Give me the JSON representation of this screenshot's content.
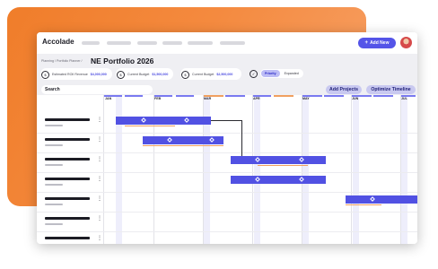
{
  "app": {
    "name": "Accolade"
  },
  "header": {
    "add_new_label": "Add New",
    "breadcrumb": "Planning / Portfolio Planner /",
    "title": "NE Portfolio 2026"
  },
  "kpis": [
    {
      "label": "Estimated ROII Revenue",
      "value": "$4,000,000",
      "icon": "$"
    },
    {
      "label": "Current Budget",
      "value": "$1,500,000",
      "icon": "$"
    },
    {
      "label": "Current Budget",
      "value": "$2,500,000",
      "icon": "$"
    }
  ],
  "view_toggle": {
    "options": [
      "Priority",
      "Expanded"
    ],
    "selected": "Priority",
    "icon": "check"
  },
  "search": {
    "placeholder": "Search"
  },
  "actions": {
    "add_projects": "Add Projects",
    "optimize_timeline": "Optimize Timeline"
  },
  "timeline": {
    "months": [
      "JAN",
      "FEB",
      "MAR",
      "APR",
      "MAY",
      "JUN",
      "JUL"
    ],
    "rows": 7,
    "colors": {
      "bar": "#5151e3",
      "accent": "#f0a060",
      "week_highlight": "#eeeefb"
    }
  },
  "colors": {
    "brand_orange": "#f07d2a",
    "primary": "#5454e8"
  }
}
